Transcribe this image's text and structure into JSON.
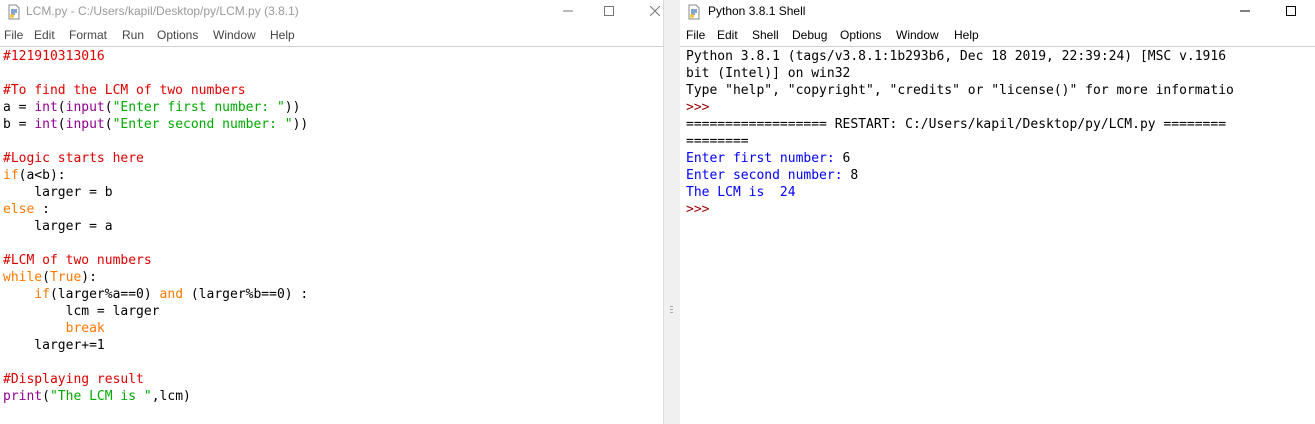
{
  "editor": {
    "title": "LCM.py - C:/Users/kapil/Desktop/py/LCM.py (3.8.1)",
    "menu": [
      "File",
      "Edit",
      "Format",
      "Run",
      "Options",
      "Window",
      "Help"
    ],
    "lines": [
      {
        "t": "cm",
        "v": "#121910313016"
      },
      {
        "t": "df",
        "v": ""
      },
      {
        "t": "cm",
        "v": "#To find the LCM of two numbers"
      },
      {
        "t": "mix",
        "parts": [
          [
            "df",
            "a = "
          ],
          [
            "bi",
            "int"
          ],
          [
            "df",
            "("
          ],
          [
            "bi",
            "input"
          ],
          [
            "df",
            "("
          ],
          [
            "st",
            "\"Enter first number: \""
          ],
          [
            "df",
            "))"
          ]
        ]
      },
      {
        "t": "mix",
        "parts": [
          [
            "df",
            "b = "
          ],
          [
            "bi",
            "int"
          ],
          [
            "df",
            "("
          ],
          [
            "bi",
            "input"
          ],
          [
            "df",
            "("
          ],
          [
            "st",
            "\"Enter second number: \""
          ],
          [
            "df",
            "))"
          ]
        ]
      },
      {
        "t": "df",
        "v": ""
      },
      {
        "t": "cm",
        "v": "#Logic starts here"
      },
      {
        "t": "mix",
        "parts": [
          [
            "kw",
            "if"
          ],
          [
            "df",
            "(a<b):"
          ]
        ]
      },
      {
        "t": "df",
        "v": "    larger = b"
      },
      {
        "t": "mix",
        "parts": [
          [
            "kw",
            "else"
          ],
          [
            "df",
            " :"
          ]
        ]
      },
      {
        "t": "df",
        "v": "    larger = a"
      },
      {
        "t": "df",
        "v": ""
      },
      {
        "t": "cm",
        "v": "#LCM of two numbers"
      },
      {
        "t": "mix",
        "parts": [
          [
            "kw",
            "while"
          ],
          [
            "df",
            "("
          ],
          [
            "kw",
            "True"
          ],
          [
            "df",
            "):"
          ]
        ]
      },
      {
        "t": "mix",
        "parts": [
          [
            "df",
            "    "
          ],
          [
            "kw",
            "if"
          ],
          [
            "df",
            "(larger%a==0) "
          ],
          [
            "kw",
            "and"
          ],
          [
            "df",
            " (larger%b==0) :"
          ]
        ]
      },
      {
        "t": "df",
        "v": "        lcm = larger"
      },
      {
        "t": "mix",
        "parts": [
          [
            "df",
            "        "
          ],
          [
            "kw",
            "break"
          ]
        ]
      },
      {
        "t": "df",
        "v": "    larger+=1"
      },
      {
        "t": "df",
        "v": ""
      },
      {
        "t": "cm",
        "v": "#Displaying result"
      },
      {
        "t": "mix",
        "parts": [
          [
            "bi",
            "print"
          ],
          [
            "df",
            "("
          ],
          [
            "st",
            "\"The LCM is \""
          ],
          [
            "df",
            ",lcm)"
          ]
        ]
      }
    ]
  },
  "shell": {
    "title": "Python 3.8.1 Shell",
    "menu": [
      "File",
      "Edit",
      "Shell",
      "Debug",
      "Options",
      "Window",
      "Help"
    ],
    "lines": [
      {
        "t": "df",
        "v": "Python 3.8.1 (tags/v3.8.1:1b293b6, Dec 18 2019, 22:39:24) [MSC v.1916"
      },
      {
        "t": "df",
        "v": "bit (Intel)] on win32"
      },
      {
        "t": "df",
        "v": "Type \"help\", \"copyright\", \"credits\" or \"license()\" for more informatio"
      },
      {
        "t": "pr",
        "v": ">>> "
      },
      {
        "t": "rs",
        "v": "================== RESTART: C:/Users/kapil/Desktop/py/LCM.py ========"
      },
      {
        "t": "rs",
        "v": "========"
      },
      {
        "t": "mix",
        "parts": [
          [
            "out",
            "Enter first number: "
          ],
          [
            "df",
            "6"
          ]
        ]
      },
      {
        "t": "mix",
        "parts": [
          [
            "out",
            "Enter second number: "
          ],
          [
            "df",
            "8"
          ]
        ]
      },
      {
        "t": "out",
        "v": "The LCM is  24"
      },
      {
        "t": "pr",
        "v": ">>> "
      }
    ]
  },
  "colors": {
    "comment": "#dd0000",
    "keyword": "#ff7700",
    "builtin": "#900090",
    "string": "#00aa00",
    "output": "#0000ff",
    "prompt": "#990000"
  },
  "icons": {
    "title_icon": "idle-python-file-icon",
    "minimize": "minimize-icon",
    "maximize": "maximize-icon",
    "close": "close-icon"
  }
}
